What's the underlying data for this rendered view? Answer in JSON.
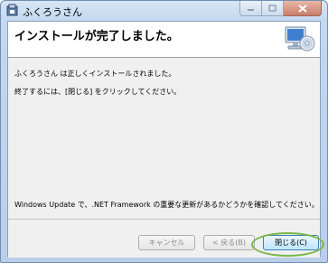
{
  "window": {
    "title": "ふくろうさん"
  },
  "banner": {
    "heading": "インストールが完了しました。",
    "icon": "computer-cd-icon"
  },
  "messages": {
    "line1": "ふくろうさん は正しくインストールされました。",
    "line2": "終了するには、[閉じる] をクリックしてください。",
    "line3": "Windows Update で、.NET Framework の重要な更新があるかどうかを確認してください。"
  },
  "buttons": {
    "cancel": "キャンセル",
    "back": "< 戻る(B)",
    "close": "閉じる(C)"
  },
  "colors": {
    "highlight": "#7ab648",
    "accent": "#3c7fb1"
  }
}
